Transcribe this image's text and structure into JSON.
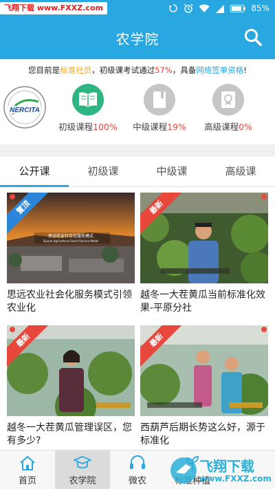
{
  "status_bar": {
    "watermark": "飞翔下载 www.FXXZ.com",
    "battery": "85%",
    "icons": [
      "sync-icon",
      "alarm-icon",
      "wifi-icon",
      "signal-icon",
      "battery-icon"
    ]
  },
  "header": {
    "title": "农学院",
    "search_icon": "search-icon"
  },
  "member_info": {
    "prefix": "您目前是",
    "member_type": "标准社员",
    "middle": "，初级课考试通过",
    "pass_rate": "57%",
    "middle2": "，具备",
    "qualification": "网络签单资格",
    "suffix": "!"
  },
  "logo_text": "NERCITA",
  "levels": [
    {
      "label": "初级课程",
      "percent": "100%",
      "icon": "book-icon",
      "color": "#2fb582"
    },
    {
      "label": "中级课程",
      "percent": "19%",
      "icon": "notebook-icon",
      "color": "#c6c6c6"
    },
    {
      "label": "高级课程",
      "percent": "0%",
      "icon": "certificate-icon",
      "color": "#c6c6c6"
    }
  ],
  "tabs": [
    "公开课",
    "初级课",
    "中级课",
    "高级课"
  ],
  "active_tab": "公开课",
  "courses": [
    {
      "title": "思远农业社会化服务模式引领农业化",
      "ribbon": "置顶",
      "ribbon_color": "#2b86d9",
      "caption": "思远农业社会化服务模式",
      "caption2": "Siyuan Agricultural Social Service Model"
    },
    {
      "title": "越冬一大茬黄瓜当前标准化效果-平原分社",
      "ribbon": "最新",
      "ribbon_color": "#e8473b"
    },
    {
      "title": "越冬一大茬黄瓜管理误区，您有多少?",
      "ribbon": "最新",
      "ribbon_color": "#e8473b"
    },
    {
      "title": "西葫芦后期长势这么好，源于标准化",
      "ribbon": "最新",
      "ribbon_color": "#e8473b"
    }
  ],
  "bottom_nav": [
    {
      "label": "首页",
      "icon": "home-icon"
    },
    {
      "label": "农学院",
      "icon": "graduation-cap-icon"
    },
    {
      "label": "微农",
      "icon": "headset-icon"
    },
    {
      "label": "标准种植",
      "icon": "plant-icon"
    }
  ],
  "active_nav": "农学院",
  "site_watermark": {
    "line1": "飞翔下载",
    "line2": "www.FXXZ.com"
  },
  "colors": {
    "primary": "#29a7e1",
    "accent_red": "#e8473b",
    "accent_orange": "#f5a623",
    "green": "#2fb582"
  }
}
